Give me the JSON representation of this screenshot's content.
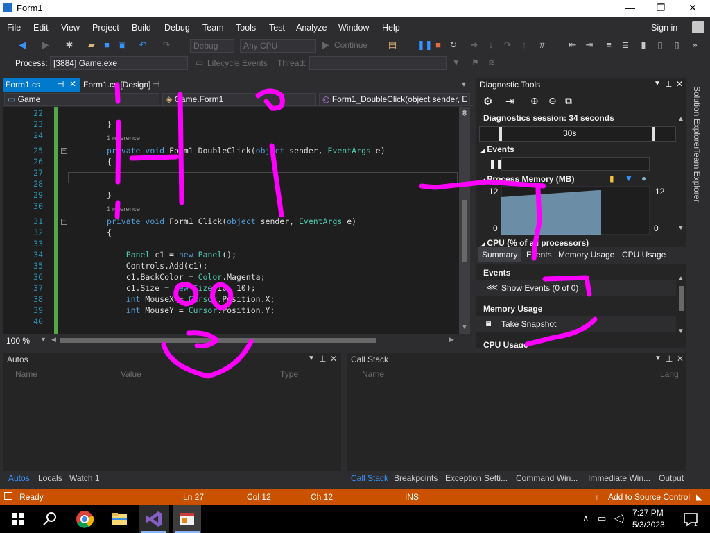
{
  "window": {
    "title": "Form1",
    "minimize_glyph": "—",
    "maximize_glyph": "❐",
    "close_glyph": "✕"
  },
  "menu": [
    "File",
    "Edit",
    "View",
    "Project",
    "Build",
    "Debug",
    "Team",
    "Tools",
    "Test",
    "Analyze",
    "Window",
    "Help"
  ],
  "sign_in": "Sign in",
  "toolbar": {
    "config": "Debug",
    "platform": "Any CPU",
    "continue": "Continue"
  },
  "process_bar": {
    "label": "Process:",
    "process": "[3884] Game.exe",
    "lifecycle": "Lifecycle Events",
    "thread_label": "Thread:"
  },
  "doc_tabs": [
    {
      "label": "Form1.cs",
      "active": true
    },
    {
      "label": "Form1.cs [Design]",
      "active": false
    }
  ],
  "nav": {
    "project": "Game",
    "class": "Game.Form1",
    "member": "Form1_DoubleClick(object sender, E"
  },
  "code_lines": [
    {
      "num": "22",
      "html": ""
    },
    {
      "num": "23",
      "html": "}"
    },
    {
      "num": "24",
      "html": ""
    },
    {
      "num": "25",
      "html": "<span class='kw'>private</span> <span class='kw'>void</span> Form1_DoubleClick(<span class='kw'>object</span> sender, <span class='ty'>EventArgs</span> e)",
      "lens": "1 reference"
    },
    {
      "num": "26",
      "html": "{"
    },
    {
      "num": "27",
      "html": ""
    },
    {
      "num": "28",
      "html": ""
    },
    {
      "num": "29",
      "html": "}"
    },
    {
      "num": "30",
      "html": ""
    },
    {
      "num": "31",
      "html": "<span class='kw'>private</span> <span class='kw'>void</span> Form1_Click(<span class='kw'>object</span> sender, <span class='ty'>EventArgs</span> e)",
      "lens": "1 reference"
    },
    {
      "num": "32",
      "html": "{"
    },
    {
      "num": "33",
      "html": ""
    },
    {
      "num": "34",
      "html": "    <span class='ty'>Panel</span> c1 = <span class='kw'>new</span> <span class='ty'>Panel</span>();"
    },
    {
      "num": "35",
      "html": "    Controls.Add(c1);"
    },
    {
      "num": "36",
      "html": "    c1.BackColor = <span class='ty'>Color</span>.Magenta;"
    },
    {
      "num": "37",
      "html": "    c1.Size = <span class='kw'>new</span> <span class='ty'>Size</span>(10, 10);"
    },
    {
      "num": "38",
      "html": "    <span class='kw'>int</span> MouseX = <span class='ty'>Cursor</span>.Position.X;"
    },
    {
      "num": "39",
      "html": "    <span class='kw'>int</span> MouseY = <span class='ty'>Cursor</span>.Position.Y;"
    },
    {
      "num": "40",
      "html": ""
    }
  ],
  "zoom": "100 %",
  "diagnostic": {
    "title": "Diagnostic Tools",
    "session": "Diagnostics session: 34 seconds",
    "timeline_label": "30s",
    "events_head": "Events",
    "memory_head": "Process Memory (MB)",
    "mem_max": "12",
    "mem_min": "0",
    "mem_max_r": "12",
    "mem_min_r": "0",
    "cpu_head": "CPU (% of all processors)",
    "tabs": [
      "Summary",
      "Events",
      "Memory Usage",
      "CPU Usage"
    ],
    "summary_events_head": "Events",
    "show_events": "Show Events (0 of 0)",
    "summary_memory_head": "Memory Usage",
    "take_snapshot": "Take Snapshot",
    "summary_cpu_head": "CPU Usage"
  },
  "side_tabs": [
    "Solution Explorer",
    "Team Explorer"
  ],
  "autos": {
    "title": "Autos",
    "columns": [
      "Name",
      "Value",
      "Type"
    ],
    "tabs": [
      "Autos",
      "Locals",
      "Watch 1"
    ]
  },
  "callstack": {
    "title": "Call Stack",
    "columns": [
      "Name",
      "Lang"
    ],
    "tabs": [
      "Call Stack",
      "Breakpoints",
      "Exception Setti...",
      "Command Win...",
      "Immediate Win...",
      "Output"
    ]
  },
  "status": {
    "ready": "Ready",
    "ln": "Ln 27",
    "col": "Col 12",
    "ch": "Ch 12",
    "ins": "INS",
    "source_control": "Add to Source Control"
  },
  "taskbar": {
    "time": "7:27 PM",
    "date": "5/3/2023"
  },
  "colors": {
    "accent": "#007acc",
    "status_bar": "#ca5100",
    "annotation": "#ff00ff"
  }
}
